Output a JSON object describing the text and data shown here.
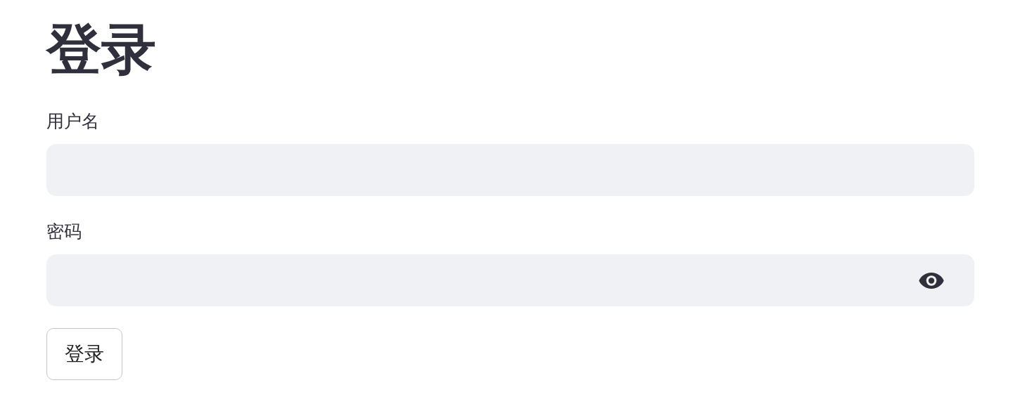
{
  "title": "登录",
  "fields": [
    {
      "label": "用户名",
      "kind": "text"
    },
    {
      "label": "密码",
      "kind": "password"
    }
  ],
  "submit_button": "登录"
}
